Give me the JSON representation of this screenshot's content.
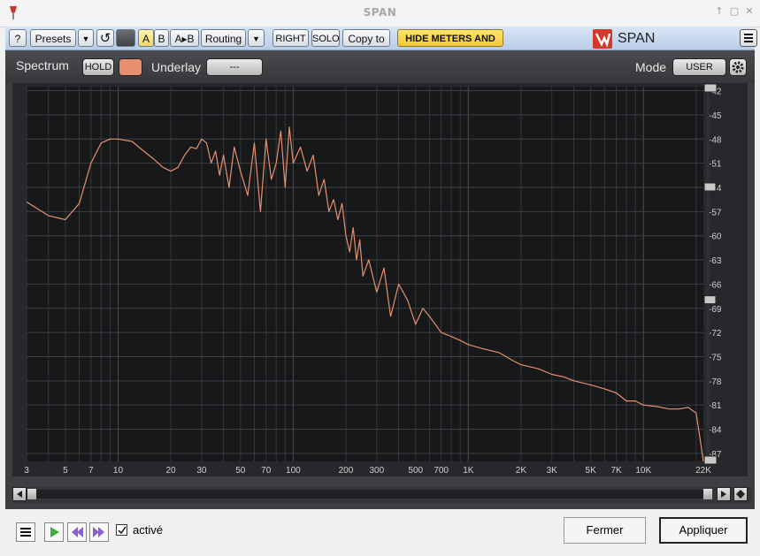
{
  "window": {
    "title": "SPAN",
    "minimize": "▢",
    "restore": "▢",
    "close": "✕",
    "pin": "↑"
  },
  "toolbar": {
    "help": "?",
    "presets": "Presets",
    "dropdown": "▼",
    "undo": "↺",
    "a": "A",
    "b": "B",
    "ab": "A▸B",
    "routing": "Routing",
    "right": "RIGHT",
    "solo": "SOLO",
    "copy_to": "Copy to",
    "hide_meters": "HIDE METERS AND STATS",
    "brand": "SPAN"
  },
  "plugin": {
    "spectrum_label": "Spectrum",
    "hold": "HOLD",
    "underlay_label": "Underlay",
    "underlay_value": "---",
    "mode_label": "Mode",
    "mode_value": "USER",
    "accent_color": "#e6906e"
  },
  "footer": {
    "active_label": "activé",
    "active_checked": true,
    "close": "Fermer",
    "apply": "Appliquer"
  },
  "chart_data": {
    "type": "line",
    "x_scale": "log",
    "x_tick_labels": [
      "3",
      "5",
      "7",
      "10",
      "20",
      "30",
      "50",
      "70",
      "100",
      "200",
      "300",
      "500",
      "700",
      "1K",
      "2K",
      "3K",
      "5K",
      "7K",
      "10K",
      "22K"
    ],
    "x_tick_values": [
      3,
      5,
      7,
      10,
      20,
      30,
      50,
      70,
      100,
      200,
      300,
      500,
      700,
      1000,
      2000,
      3000,
      5000,
      7000,
      10000,
      22000
    ],
    "y_tick_labels": [
      "-42",
      "-45",
      "-48",
      "-51",
      "-54",
      "-57",
      "-60",
      "-63",
      "-66",
      "-69",
      "-72",
      "-75",
      "-78",
      "-81",
      "-84",
      "-87"
    ],
    "ylim": [
      -88,
      -41.5
    ],
    "xlim": [
      3,
      22000
    ],
    "grid": true,
    "series": [
      {
        "color": "#e6906e",
        "x": [
          3,
          4,
          5,
          6,
          7,
          8,
          9,
          10,
          12,
          14,
          16,
          18,
          20,
          22,
          24,
          26,
          28,
          30,
          32,
          34,
          36,
          38,
          40,
          43,
          46,
          50,
          55,
          60,
          65,
          70,
          75,
          80,
          85,
          90,
          95,
          100,
          110,
          120,
          130,
          140,
          150,
          160,
          170,
          180,
          190,
          200,
          210,
          220,
          230,
          240,
          250,
          270,
          300,
          330,
          360,
          400,
          450,
          500,
          550,
          600,
          700,
          800,
          900,
          1000,
          1200,
          1500,
          1800,
          2000,
          2500,
          3000,
          3500,
          4000,
          5000,
          6000,
          7000,
          8000,
          9000,
          10000,
          12000,
          14000,
          16000,
          18000,
          20000,
          21000,
          22000
        ],
        "y": [
          -55.8,
          -57.5,
          -58,
          -56,
          -51,
          -48.5,
          -48,
          -48,
          -48.3,
          -49.5,
          -50.5,
          -51.5,
          -52,
          -51.5,
          -50,
          -49,
          -49.2,
          -48,
          -48.5,
          -51,
          -49.5,
          -52.5,
          -50,
          -54,
          -49,
          -52,
          -55,
          -48.5,
          -57,
          -48,
          -53,
          -51,
          -47,
          -54,
          -46.5,
          -51,
          -49,
          -52,
          -50,
          -55,
          -53,
          -57,
          -55.5,
          -58,
          -56,
          -60,
          -62,
          -59,
          -63,
          -60.5,
          -65,
          -63,
          -67,
          -64,
          -70,
          -66,
          -68,
          -71,
          -69,
          -70,
          -72,
          -72.5,
          -73,
          -73.5,
          -74,
          -74.5,
          -75.5,
          -76,
          -76.5,
          -77.2,
          -77.5,
          -78,
          -78.5,
          -79,
          -79.5,
          -80.5,
          -80.5,
          -81,
          -81.2,
          -81.5,
          -81.5,
          -81.3,
          -82,
          -85,
          -88
        ]
      }
    ]
  }
}
